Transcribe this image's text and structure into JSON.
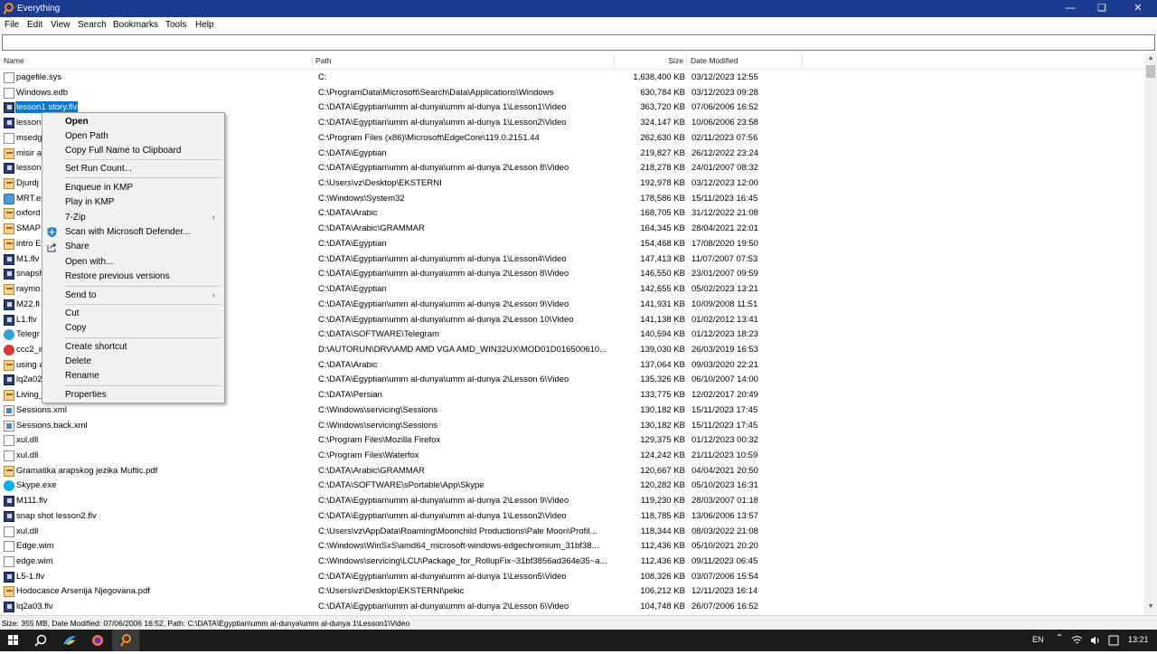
{
  "window": {
    "title": "Everything"
  },
  "menu": [
    "File",
    "Edit",
    "View",
    "Search",
    "Bookmarks",
    "Tools",
    "Help"
  ],
  "search": {
    "value": ""
  },
  "columns": {
    "name": "Name",
    "path": "Path",
    "size": "Size",
    "date": "Date Modified"
  },
  "rows": [
    {
      "icon": "doc",
      "name": "pagefile.sys",
      "path": "C:",
      "size": "1,638,400 KB",
      "date": "03/12/2023 12:55"
    },
    {
      "icon": "doc",
      "name": "Windows.edb",
      "path": "C:\\ProgramData\\Microsoft\\Search\\Data\\Applications\\Windows",
      "size": "630,784 KB",
      "date": "03/12/2023 09:28"
    },
    {
      "icon": "vid",
      "name": "lesson1 story.flv",
      "path": "C:\\DATA\\Egyptian\\umm al-dunya\\umm al-dunya 1\\Lesson1\\Video",
      "size": "363,720 KB",
      "date": "07/06/2006 16:52",
      "selected": true
    },
    {
      "icon": "vid",
      "name": "lesson",
      "path": "C:\\DATA\\Egyptian\\umm al-dunya\\umm al-dunya 1\\Lesson2\\Video",
      "size": "324,147 KB",
      "date": "10/06/2006 23:58"
    },
    {
      "icon": "doc",
      "name": "msedg",
      "path": "C:\\Program Files (x86)\\Microsoft\\EdgeCore\\119.0.2151.44",
      "size": "262,630 KB",
      "date": "02/11/2023 07:56"
    },
    {
      "icon": "pdf",
      "name": "misir a",
      "path": "C:\\DATA\\Egyptian",
      "size": "219,827 KB",
      "date": "26/12/2022 23:24"
    },
    {
      "icon": "vid",
      "name": "lesson",
      "path": "C:\\DATA\\Egyptian\\umm al-dunya\\umm al-dunya 2\\Lesson 8\\Video",
      "size": "218,278 KB",
      "date": "24/01/2007 08:32"
    },
    {
      "icon": "pdf",
      "name": "Djurdj",
      "path": "C:\\Users\\vz\\Desktop\\EKSTERNI",
      "size": "192,978 KB",
      "date": "03/12/2023 12:00"
    },
    {
      "icon": "exe",
      "name": "MRT.ex",
      "path": "C:\\Windows\\System32",
      "size": "178,586 KB",
      "date": "15/11/2023 16:45"
    },
    {
      "icon": "pdf",
      "name": "oxford",
      "path": "C:\\DATA\\Arabic",
      "size": "168,705 KB",
      "date": "31/12/2022 21:08"
    },
    {
      "icon": "pdf",
      "name": "SMAP",
      "path": "C:\\DATA\\Arabic\\GRAMMAR",
      "size": "164,345 KB",
      "date": "28/04/2021 22:01"
    },
    {
      "icon": "pdf",
      "name": "intro E",
      "path": "C:\\DATA\\Egyptian",
      "size": "154,468 KB",
      "date": "17/08/2020 19:50"
    },
    {
      "icon": "vid",
      "name": "M1.flv",
      "path": "C:\\DATA\\Egyptian\\umm al-dunya\\umm al-dunya 1\\Lesson4\\Video",
      "size": "147,413 KB",
      "date": "11/07/2007 07:53"
    },
    {
      "icon": "vid",
      "name": "snapsh",
      "path": "C:\\DATA\\Egyptian\\umm al-dunya\\umm al-dunya 2\\Lesson 8\\Video",
      "size": "146,550 KB",
      "date": "23/01/2007 09:59"
    },
    {
      "icon": "pdf",
      "name": "raymo",
      "path": "C:\\DATA\\Egyptian",
      "size": "142,655 KB",
      "date": "05/02/2023 13:21"
    },
    {
      "icon": "vid",
      "name": "M22.fl",
      "path": "C:\\DATA\\Egyptian\\umm al-dunya\\umm al-dunya 2\\Lesson 9\\Video",
      "size": "141,931 KB",
      "date": "10/09/2008 11:51"
    },
    {
      "icon": "vid",
      "name": "L1.flv",
      "path": "C:\\DATA\\Egyptian\\umm al-dunya\\umm al-dunya 2\\Lesson 10\\Video",
      "size": "141,138 KB",
      "date": "01/02/2012 13:41"
    },
    {
      "icon": "tg",
      "name": "Telegr",
      "path": "C:\\DATA\\SOFTWARE\\Telegram",
      "size": "140,594 KB",
      "date": "01/12/2023 18:23"
    },
    {
      "icon": "red",
      "name": "ccc2_ir",
      "path": "D:\\AUTORUN\\DRV\\AMD AMD VGA AMD_WIN32UX\\MOD01D016500610...",
      "size": "139,030 KB",
      "date": "26/03/2019 16:53"
    },
    {
      "icon": "pdf",
      "name": "using a",
      "path": "C:\\DATA\\Arabic",
      "size": "137,064 KB",
      "date": "09/03/2020 22:21"
    },
    {
      "icon": "vid",
      "name": "lq2a02",
      "path": "C:\\DATA\\Egyptian\\umm al-dunya\\umm al-dunya 2\\Lesson 6\\Video",
      "size": "135,326 KB",
      "date": "06/10/2007 14:00"
    },
    {
      "icon": "pdf",
      "name": "Living_",
      "path": "C:\\DATA\\Persian",
      "size": "133,775 KB",
      "date": "12/02/2017 20:49"
    },
    {
      "icon": "xml",
      "name": "Sessions.xml",
      "path": "C:\\Windows\\servicing\\Sessions",
      "size": "130,182 KB",
      "date": "15/11/2023 17:45"
    },
    {
      "icon": "xml",
      "name": "Sessions.back.xml",
      "path": "C:\\Windows\\servicing\\Sessions",
      "size": "130,182 KB",
      "date": "15/11/2023 17:45"
    },
    {
      "icon": "doc",
      "name": "xul.dll",
      "path": "C:\\Program Files\\Mozilla Firefox",
      "size": "129,375 KB",
      "date": "01/12/2023 00:32"
    },
    {
      "icon": "doc",
      "name": "xul.dll",
      "path": "C:\\Program Files\\Waterfox",
      "size": "124,242 KB",
      "date": "21/11/2023 10:59"
    },
    {
      "icon": "pdf",
      "name": "Gramatika arapskog jezika Muftic.pdf",
      "path": "C:\\DATA\\Arabic\\GRAMMAR",
      "size": "120,667 KB",
      "date": "04/04/2021 20:50"
    },
    {
      "icon": "sk",
      "name": "Skype.exe",
      "path": "C:\\DATA\\SOFTWARE\\sPortable\\App\\Skype",
      "size": "120,282 KB",
      "date": "05/10/2023 16:31"
    },
    {
      "icon": "vid",
      "name": "M111.flv",
      "path": "C:\\DATA\\Egyptian\\umm al-dunya\\umm al-dunya 2\\Lesson 9\\Video",
      "size": "119,230 KB",
      "date": "28/03/2007 01:18"
    },
    {
      "icon": "vid",
      "name": "snap shot lesson2.flv",
      "path": "C:\\DATA\\Egyptian\\umm al-dunya\\umm al-dunya 1\\Lesson2\\Video",
      "size": "118,785 KB",
      "date": "13/06/2006 13:57"
    },
    {
      "icon": "doc",
      "name": "xul.dll",
      "path": "C:\\Users\\vz\\AppData\\Roaming\\Moonchild Productions\\Pale Moon\\Profil...",
      "size": "118,344 KB",
      "date": "08/03/2022 21:08"
    },
    {
      "icon": "doc",
      "name": "Edge.wim",
      "path": "C:\\Windows\\WinSxS\\amd64_microsoft-windows-edgechromium_31bf38...",
      "size": "112,436 KB",
      "date": "05/10/2021 20:20"
    },
    {
      "icon": "doc",
      "name": "edge.wim",
      "path": "C:\\Windows\\servicing\\LCU\\Package_for_RollupFix~31bf3856ad364e35~a...",
      "size": "112,436 KB",
      "date": "09/11/2023 06:45"
    },
    {
      "icon": "vid",
      "name": "L5-1.flv",
      "path": "C:\\DATA\\Egyptian\\umm al-dunya\\umm al-dunya 1\\Lesson5\\Video",
      "size": "108,326 KB",
      "date": "03/07/2006 15:54"
    },
    {
      "icon": "pdf",
      "name": "Hodocasce Arsenija Njegovana.pdf",
      "path": "C:\\Users\\vz\\Desktop\\EKSTERNI\\pekic",
      "size": "106,212 KB",
      "date": "12/11/2023 16:14"
    },
    {
      "icon": "vid",
      "name": "lq2a03.flv",
      "path": "C:\\DATA\\Egyptian\\umm al-dunya\\umm al-dunya 2\\Lesson 6\\Video",
      "size": "104,748 KB",
      "date": "26/07/2006 16:52"
    }
  ],
  "context_menu": {
    "open": "Open",
    "open_path": "Open Path",
    "copy_full_name": "Copy Full Name to Clipboard",
    "set_run_count": "Set Run Count...",
    "enqueue_kmp": "Enqueue in KMP",
    "play_kmp": "Play in KMP",
    "seven_zip": "7-Zip",
    "scan_defender": "Scan with Microsoft Defender...",
    "share": "Share",
    "open_with": "Open with...",
    "restore_versions": "Restore previous versions",
    "send_to": "Send to",
    "cut": "Cut",
    "copy": "Copy",
    "create_shortcut": "Create shortcut",
    "delete": "Delete",
    "rename": "Rename",
    "properties": "Properties"
  },
  "status": {
    "text": "Size: 355 MB, Date Modified: 07/06/2006 16:52, Path: C:\\DATA\\Egyptian\\umm al-dunya\\umm al-dunya 1\\Lesson1\\Video"
  },
  "taskbar": {
    "lang": "EN",
    "time": "13:21"
  },
  "colors": {
    "titlebar": "#1a3b8f",
    "selection": "#0078d7",
    "taskbar": "#1b1b1b"
  }
}
